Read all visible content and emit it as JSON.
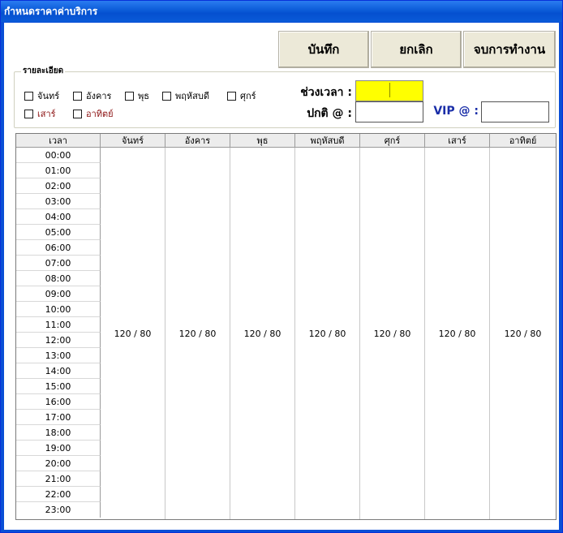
{
  "window": {
    "title": "กำหนดราคาค่าบริการ"
  },
  "toolbar": {
    "save_label": "บันทึก",
    "cancel_label": "ยกเลิก",
    "exit_label": "จบการทำงาน"
  },
  "details": {
    "group_label": "รายละเอียด",
    "days": [
      "จันทร์",
      "อังคาร",
      "พุธ",
      "พฤหัสบดี",
      "ศุกร์",
      "เสาร์",
      "อาทิตย์"
    ],
    "time_range_label": "ช่วงเวลา :",
    "time_range_value": "",
    "normal_label": "ปกติ @ :",
    "normal_value": "",
    "vip_label": "VIP @ :",
    "vip_value": ""
  },
  "grid": {
    "time_header": "เวลา",
    "day_headers": [
      "จันทร์",
      "อังคาร",
      "พุธ",
      "พฤหัสบดี",
      "ศุกร์",
      "เสาร์",
      "อาทิตย์"
    ],
    "hours": [
      "00:00",
      "01:00",
      "02:00",
      "03:00",
      "04:00",
      "05:00",
      "06:00",
      "07:00",
      "08:00",
      "09:00",
      "10:00",
      "11:00",
      "12:00",
      "13:00",
      "14:00",
      "15:00",
      "16:00",
      "17:00",
      "18:00",
      "19:00",
      "20:00",
      "21:00",
      "22:00",
      "23:00"
    ],
    "day_prices": [
      "120 / 80",
      "120 / 80",
      "120 / 80",
      "120 / 80",
      "120 / 80",
      "120 / 80",
      "120 / 80"
    ]
  },
  "colors": {
    "titlebar": "#0a5ad8",
    "highlight_field": "#ffff00",
    "weekend_text": "#8b1010",
    "vip_label": "#1a2ea8"
  }
}
